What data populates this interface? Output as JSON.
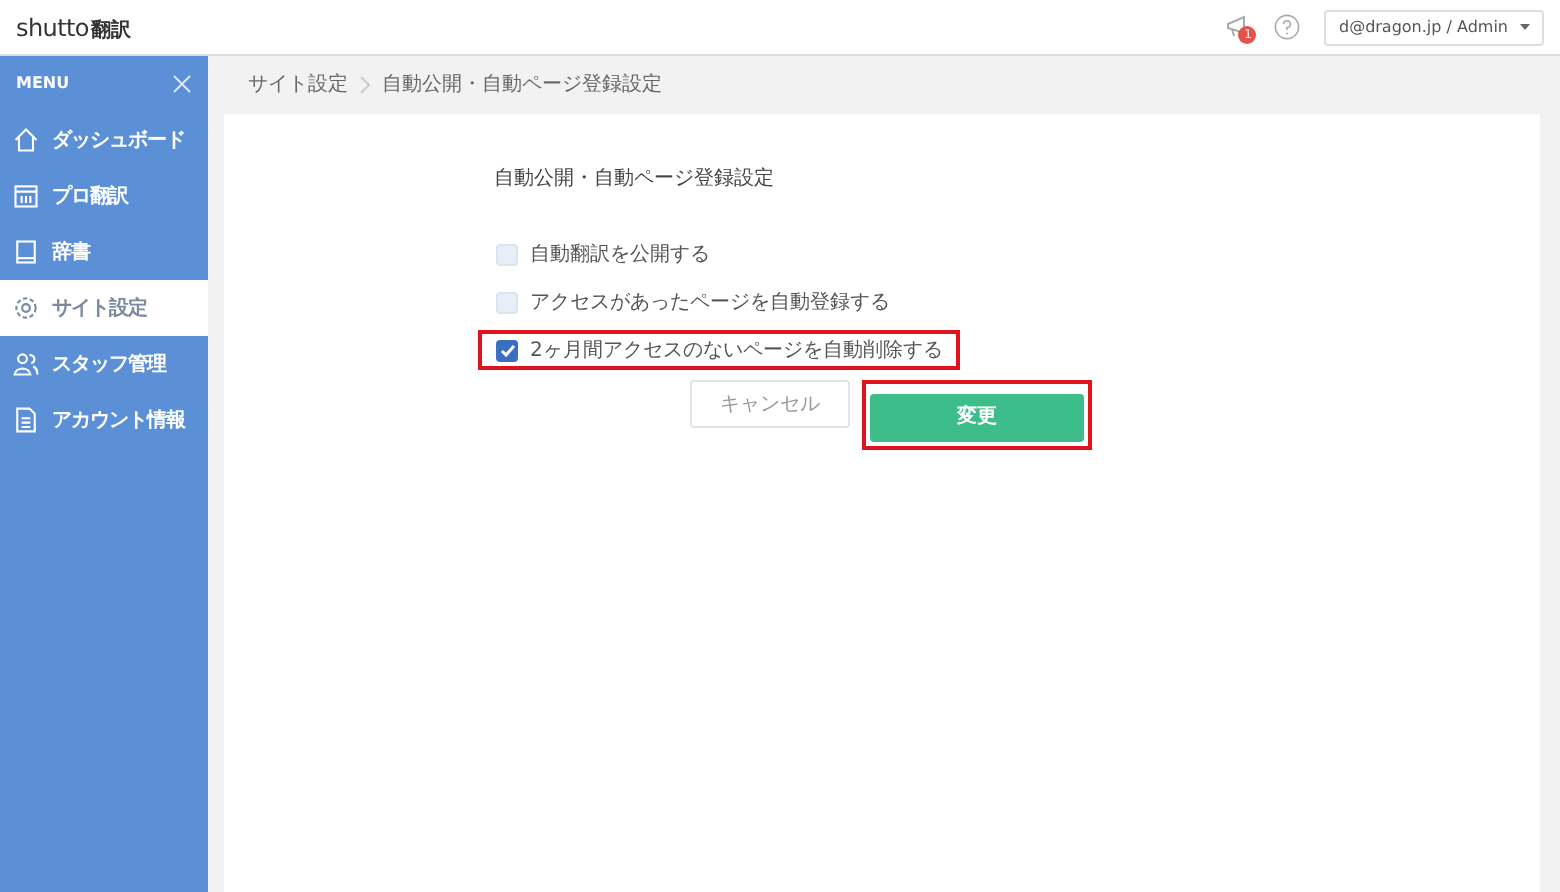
{
  "header": {
    "logo": {
      "latin": "shutto",
      "kanji": "翻訳"
    },
    "notification_count": "1",
    "account": "d@dragon.jp / Admin"
  },
  "sidebar": {
    "title": "MENU",
    "items": [
      {
        "label": "ダッシュボード",
        "selected": false
      },
      {
        "label": "プロ翻訳",
        "selected": false
      },
      {
        "label": "辞書",
        "selected": false
      },
      {
        "label": "サイト設定",
        "selected": true
      },
      {
        "label": "スタッフ管理",
        "selected": false
      },
      {
        "label": "アカウント情報",
        "selected": false
      }
    ]
  },
  "breadcrumb": [
    "サイト設定",
    "自動公開・自動ページ登録設定"
  ],
  "form": {
    "title": "自動公開・自動ページ登録設定",
    "options": [
      {
        "label": "自動翻訳を公開する",
        "checked": false,
        "highlighted": false
      },
      {
        "label": "アクセスがあったページを自動登録する",
        "checked": false,
        "highlighted": false
      },
      {
        "label": "2ヶ月間アクセスのないページを自動削除する",
        "checked": true,
        "highlighted": true
      }
    ],
    "cancel": {
      "label": "キャンセル"
    },
    "submit": {
      "label": "変更",
      "highlighted": true
    }
  }
}
